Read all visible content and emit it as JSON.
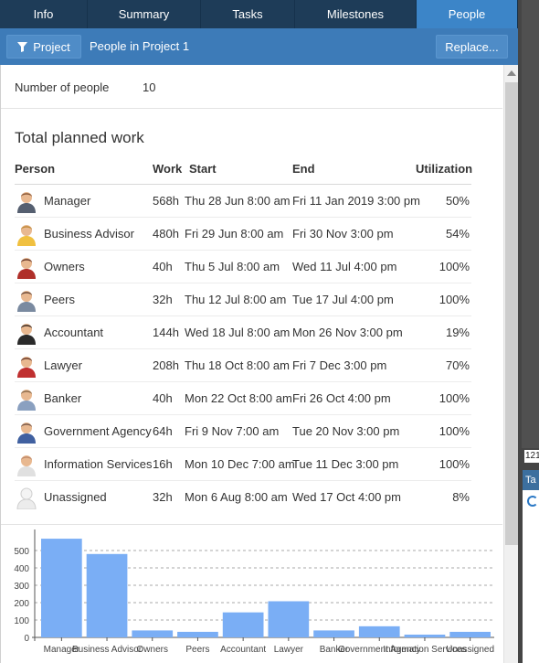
{
  "tabs": [
    {
      "label": "Info",
      "active": false
    },
    {
      "label": "Summary",
      "active": false
    },
    {
      "label": "Tasks",
      "active": false
    },
    {
      "label": "Milestones",
      "active": false
    },
    {
      "label": "People",
      "active": true
    }
  ],
  "toolbar": {
    "filter_button_label": "Project",
    "filter_icon": "filter-icon",
    "title": "People in Project 1",
    "replace_button_label": "Replace..."
  },
  "summary": {
    "count_label": "Number of people",
    "count_value": "10"
  },
  "section_title": "Total planned work",
  "columns": {
    "person": "Person",
    "work": "Work",
    "start": "Start",
    "end": "End",
    "utilization": "Utilization"
  },
  "people": [
    {
      "name": "Manager",
      "work": "568h",
      "start": "Thu 28 Jun 8:00 am",
      "end": "Fri 11 Jan 2019 3:00 pm",
      "utilization": "50%",
      "icon": "manager-avatar-icon"
    },
    {
      "name": "Business Advisor",
      "work": "480h",
      "start": "Fri 29 Jun 8:00 am",
      "end": "Fri 30 Nov 3:00 pm",
      "utilization": "54%",
      "icon": "advisor-avatar-icon"
    },
    {
      "name": "Owners",
      "work": "40h",
      "start": "Thu 5 Jul 8:00 am",
      "end": "Wed 11 Jul 4:00 pm",
      "utilization": "100%",
      "icon": "owners-avatar-icon"
    },
    {
      "name": "Peers",
      "work": "32h",
      "start": "Thu 12 Jul 8:00 am",
      "end": "Tue 17 Jul 4:00 pm",
      "utilization": "100%",
      "icon": "peers-avatar-icon"
    },
    {
      "name": "Accountant",
      "work": "144h",
      "start": "Wed 18 Jul 8:00 am",
      "end": "Mon 26 Nov 3:00 pm",
      "utilization": "19%",
      "icon": "accountant-avatar-icon"
    },
    {
      "name": "Lawyer",
      "work": "208h",
      "start": "Thu 18 Oct 8:00 am",
      "end": "Fri 7 Dec 3:00 pm",
      "utilization": "70%",
      "icon": "lawyer-avatar-icon"
    },
    {
      "name": "Banker",
      "work": "40h",
      "start": "Mon 22 Oct 8:00 am",
      "end": "Fri 26 Oct 4:00 pm",
      "utilization": "100%",
      "icon": "banker-avatar-icon"
    },
    {
      "name": "Government Agency",
      "work": "64h",
      "start": "Fri 9 Nov 7:00 am",
      "end": "Tue 20 Nov 3:00 pm",
      "utilization": "100%",
      "icon": "government-avatar-icon"
    },
    {
      "name": "Information Services",
      "work": "16h",
      "start": "Mon 10 Dec 7:00 am",
      "end": "Tue 11 Dec 3:00 pm",
      "utilization": "100%",
      "icon": "info-services-avatar-icon"
    },
    {
      "name": "Unassigned",
      "work": "32h",
      "start": "Mon 6 Aug 8:00 am",
      "end": "Wed 17 Oct 4:00 pm",
      "utilization": "8%",
      "icon": "unassigned-avatar-icon"
    }
  ],
  "chart_data": {
    "type": "bar",
    "categories": [
      "Manager",
      "Business Advisor",
      "Owners",
      "Peers",
      "Accountant",
      "Lawyer",
      "Banker",
      "Government Agency",
      "Information Services",
      "Unassigned"
    ],
    "values": [
      568,
      480,
      40,
      32,
      144,
      208,
      40,
      64,
      16,
      32
    ],
    "yticks": [
      0,
      100,
      200,
      300,
      400,
      500
    ],
    "ylim": [
      0,
      600
    ],
    "grid": true,
    "bar_color": "#7aaef5"
  },
  "right_pane": {
    "time_text": "121",
    "tab_label": "Ta"
  },
  "colors": {
    "tab_bar": "#1f3f5c",
    "tab_active": "#3c85c8",
    "toolbar": "#3d7bb8"
  }
}
